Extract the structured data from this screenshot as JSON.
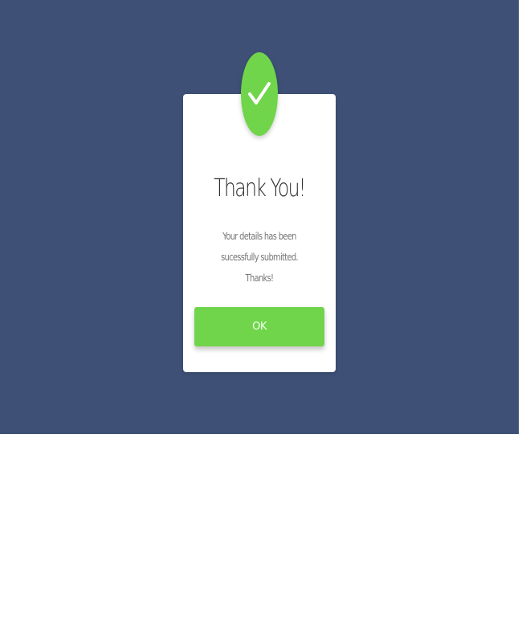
{
  "colors": {
    "backdrop": "#3e5076",
    "accent": "#70d54b",
    "modal_background": "#ffffff"
  },
  "icons": {
    "badge": "checkmark-icon"
  },
  "modal": {
    "title": "Thank You!",
    "message": "Your details has been sucessfully submitted. Thanks!",
    "ok_label": "OK"
  }
}
